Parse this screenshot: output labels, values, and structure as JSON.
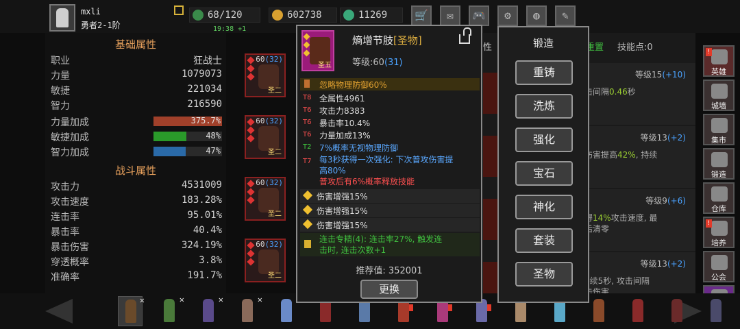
{
  "header": {
    "player_name": "mxli",
    "player_rank": "勇者2-1阶",
    "energy": "68/120",
    "gold": "602738",
    "gems": "11269",
    "timer": "19:38 +1",
    "buttons": [
      {
        "name": "shop-button",
        "icon": "cart-icon",
        "glyph": "🛒",
        "badge": "!"
      },
      {
        "name": "mail-button",
        "icon": "mail-icon",
        "glyph": "✉",
        "badge": ""
      },
      {
        "name": "gamepad-button",
        "icon": "gamepad-icon",
        "glyph": "🎮",
        "badge": ""
      },
      {
        "name": "settings-button",
        "icon": "gear-icon",
        "glyph": "⚙",
        "badge": ""
      },
      {
        "name": "color-wheel-button",
        "icon": "color-wheel-icon",
        "glyph": "◍",
        "badge": "!"
      },
      {
        "name": "feather-button",
        "icon": "feather-icon",
        "glyph": "✎",
        "badge": ""
      }
    ]
  },
  "basic_attrs": {
    "title": "基础属性",
    "rows": [
      {
        "k": "职业",
        "v": "狂战士"
      },
      {
        "k": "力量",
        "v": "1079073"
      },
      {
        "k": "敏捷",
        "v": "221034"
      },
      {
        "k": "智力",
        "v": "216590"
      }
    ],
    "bars": [
      {
        "k": "力量加成",
        "v": "375.7%",
        "fill": 1.0,
        "color": "#a0402a"
      },
      {
        "k": "敏捷加成",
        "v": "48%",
        "fill": 0.48,
        "color": "#2a9a2a"
      },
      {
        "k": "智力加成",
        "v": "47%",
        "fill": 0.47,
        "color": "#2a6aa8"
      }
    ]
  },
  "combat_attrs": {
    "title": "战斗属性",
    "rows": [
      {
        "k": "攻击力",
        "v": "4531009"
      },
      {
        "k": "攻击速度",
        "v": "183.28%"
      },
      {
        "k": "连击率",
        "v": "95.01%"
      },
      {
        "k": "暴击率",
        "v": "40.4%"
      },
      {
        "k": "暴击伤害",
        "v": "324.19%"
      },
      {
        "k": "穿透概率",
        "v": "3.8%"
      },
      {
        "k": "准确率",
        "v": "191.7%"
      }
    ]
  },
  "equip_slots": [
    {
      "lv": "60",
      "lv2": "(32)",
      "tag": "圣二"
    },
    {
      "lv": "60",
      "lv2": "(32)",
      "tag": "圣二"
    },
    {
      "lv": "60",
      "lv2": "(32)",
      "tag": "圣二"
    },
    {
      "lv": "60",
      "lv2": "(32)",
      "tag": "圣二"
    }
  ],
  "item": {
    "name": "熵增节肢",
    "quality": "[圣物]",
    "level_label": "等级:60",
    "level_extra": "(31)",
    "icon_label": "圣五",
    "icon_name": "claw-gauntlet-icon",
    "highlight": "忽略物理防御60%",
    "affixes": [
      {
        "tier": "T8",
        "text": "全属性4961",
        "color": "#dddddd",
        "tcolor": "#ff5050"
      },
      {
        "tier": "T6",
        "text": "攻击力8383",
        "color": "#dddddd",
        "tcolor": "#ff5050"
      },
      {
        "tier": "T6",
        "text": "暴击率10.4%",
        "color": "#dddddd",
        "tcolor": "#ff5050"
      },
      {
        "tier": "T6",
        "text": "力量加成13%",
        "color": "#dddddd",
        "tcolor": "#ff5050"
      },
      {
        "tier": "T2",
        "text": "7%概率无视物理防御",
        "color": "#5aa8ff",
        "tcolor": "#40d040"
      }
    ],
    "special_tier": "T7",
    "special_line1": "每3秒获得一次强化: 下次普攻伤害提",
    "special_line2": "高80%",
    "special_line3": "普攻后有6%概率释放技能",
    "gems": [
      "伤害增强15%",
      "伤害增强15%",
      "伤害增强15%"
    ],
    "set_line1": "连击专精(4): 连击率27%, 触发连",
    "set_line2": "击时, 连击次数+1",
    "recommend": "推荐值: 352001",
    "swap_label": "更换"
  },
  "forge": {
    "title": "锻造",
    "buttons": [
      "重铸",
      "洗炼",
      "强化",
      "宝石",
      "神化",
      "套装",
      "圣物"
    ]
  },
  "background": {
    "tab_fragment": "性",
    "reset_label": "重置",
    "skill_points": "技能点:0",
    "skills": [
      {
        "lvl": "等级15",
        "plus": "(+10)",
        "desc_a": "攻击间隔",
        "desc_b": "0.46",
        "desc_c": "秒"
      },
      {
        "lvl": "等级13",
        "plus": "(+2)",
        "desc_a": "击伤害提高",
        "desc_b": "42%",
        "desc_c": ", 持续"
      },
      {
        "lvl": "等级9",
        "plus": "(+6)",
        "desc_a": "获得",
        "desc_b": "14%",
        "desc_c": "攻击速度, 最"
      },
      {
        "lvl": "等级13",
        "plus": "(+2)",
        "desc_a": ", 持续5秒, 攻击间隔",
        "desc_b": "",
        "desc_c": ""
      }
    ],
    "skill_extra": [
      "",
      "5",
      "标后清零",
      "打击伤害"
    ]
  },
  "right_nav": [
    {
      "label": "英雄",
      "name": "nav-hero",
      "color": "#5a2a2a",
      "badge": "!"
    },
    {
      "label": "城墙",
      "name": "nav-wall",
      "color": "#3a3030",
      "badge": ""
    },
    {
      "label": "集市",
      "name": "nav-market",
      "color": "#3a3030",
      "badge": ""
    },
    {
      "label": "锻造",
      "name": "nav-forge",
      "color": "#3a3030",
      "badge": ""
    },
    {
      "label": "仓库",
      "name": "nav-warehouse",
      "color": "#3a3030",
      "badge": ""
    },
    {
      "label": "培养",
      "name": "nav-train",
      "color": "#3a3030",
      "badge": "!"
    },
    {
      "label": "公会",
      "name": "nav-guild",
      "color": "#3a3030",
      "badge": ""
    },
    {
      "label": "战斗",
      "name": "nav-battle",
      "color": "#6a2a8a",
      "badge": ""
    }
  ],
  "heroes": [
    "#6a4a2a",
    "#4a7a3a",
    "#5a4a8a",
    "#8a6a5a",
    "#6a8ac8",
    "#8a2a2a",
    "#5a7aa8",
    "#a83a2a",
    "#aa3a7a",
    "#6a6aa8",
    "#aa8a6a",
    "#5aa8c8",
    "#8a4a2a",
    "#8a2a2a",
    "#6a2a2a",
    "#4a4a6a"
  ]
}
